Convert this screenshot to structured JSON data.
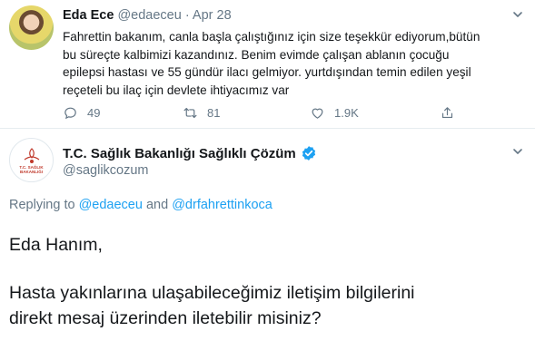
{
  "tweet": {
    "author_name": "Eda Ece",
    "author_handle": "@edaeceu",
    "separator": "·",
    "date": "Apr 28",
    "text": "Fahrettin bakanım, canla başla çalıştığınız için size teşekkür ediyorum,bütün\nbu süreçte kalbimizi kazandınız. Benim evimde çalışan ablanın çocuğu\nepilepsi hastası ve 55 gündür ilacı gelmiyor. yurtdışından temin edilen yeşil\nreçeteli bu ilaç için devlete ihtiyacımız var",
    "reply_count": "49",
    "retweet_count": "81",
    "like_count": "1.9K"
  },
  "reply": {
    "author_name": "T.C. Sağlık Bakanlığı Sağlıklı Çözüm",
    "author_handle": "@saglikcozum",
    "avatar_text": "T.C. SAĞLIK BAKANLIĞI",
    "replying_prefix": "Replying to",
    "mention_1": "@edaeceu",
    "replying_and": "and",
    "mention_2": "@drfahrettinkoca",
    "greeting": "Eda Hanım,",
    "body_line_1": "Hasta yakınlarına ulaşabileceğimiz iletişim bilgilerini",
    "body_line_2": "direkt mesaj üzerinden iletebilir misiniz?"
  },
  "colors": {
    "link": "#1da1f2",
    "muted": "#657786",
    "verified": "#1da1f2",
    "divider": "#e6ecf0"
  },
  "icons": [
    "reply-icon",
    "retweet-icon",
    "like-icon",
    "share-icon",
    "verified-badge-icon",
    "chevron-down-icon"
  ]
}
